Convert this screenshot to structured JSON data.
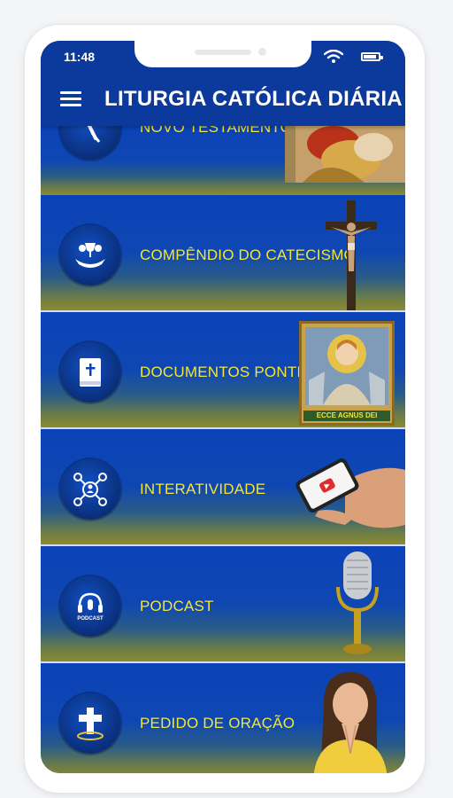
{
  "status": {
    "time": "11:48"
  },
  "appbar": {
    "title": "LITURGIA CATÓLICA DIÁRIA"
  },
  "menu": {
    "items": [
      {
        "label": "NOVO TESTAMENTO",
        "icon": "book-quill-icon",
        "image": "apostle-painting"
      },
      {
        "label": "COMPÊNDIO DO CATECISMO",
        "icon": "chalice-hands-icon",
        "image": "crucifix"
      },
      {
        "label": "DOCUMENTOS PONTIFÍCIOS",
        "icon": "bible-cross-icon",
        "image": "ecce-agnus-dei-icon-painting"
      },
      {
        "label": "INTERATIVIDADE",
        "icon": "network-people-icon",
        "image": "hand-holding-phone"
      },
      {
        "label": "PODCAST",
        "icon": "podcast-headphones-icon",
        "image": "microphone"
      },
      {
        "label": "PEDIDO DE ORAÇÃO",
        "icon": "cross-icon",
        "image": "praying-girl"
      }
    ]
  },
  "images": {
    "painting_caption": "ECCE AGNUS DEI",
    "podcast_icon_text": "PODCAST"
  },
  "colors": {
    "appbar": "#0c3a9c",
    "label_yellow": "#f2e53b",
    "item_blue": "#0b42b8"
  }
}
